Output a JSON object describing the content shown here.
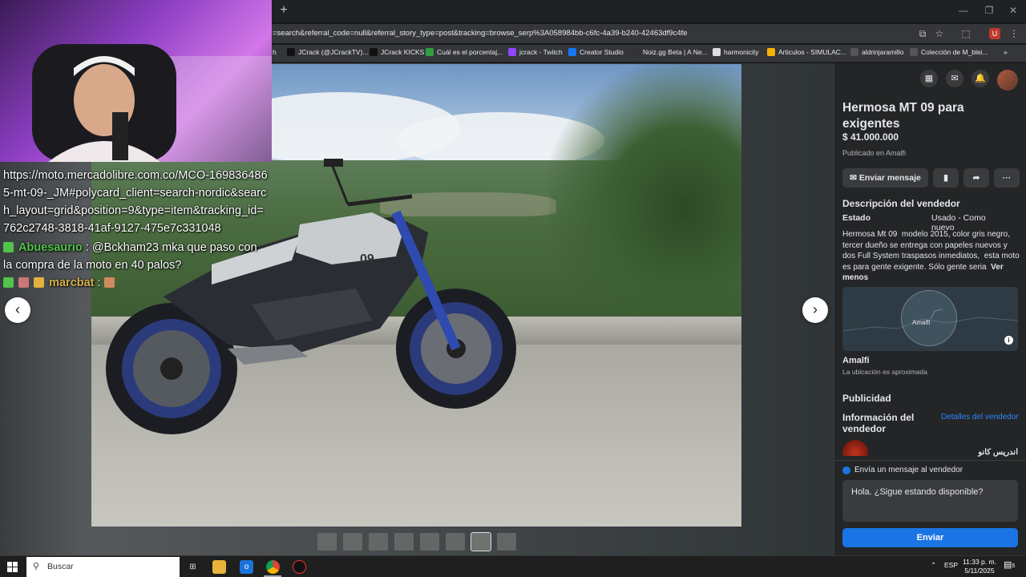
{
  "browser": {
    "url": "=search&referral_code=null&referral_story_type=post&tracking=browse_serp%3A058984bb-c6fc-4a39-b240-42463df9c4fe",
    "bookmarks": [
      {
        "label": "h",
        "color": "#444"
      },
      {
        "label": "JCrack (@JCrackTV)...",
        "color": "#111"
      },
      {
        "label": "JCrack KICKS",
        "color": "#111"
      },
      {
        "label": "Cuál es el porcentaj...",
        "color": "#2ea043"
      },
      {
        "label": "jcrack - Twitch",
        "color": "#9146ff"
      },
      {
        "label": "Creator Studio",
        "color": "#1877f2"
      },
      {
        "label": "Noiz.gg Beta | A Ne...",
        "color": "#333"
      },
      {
        "label": "harmonicity",
        "color": "#ddd"
      },
      {
        "label": "Articulos - SIMULAC...",
        "color": "#f4b400"
      },
      {
        "label": "aldrinjaramillo",
        "color": "#555"
      },
      {
        "label": "Colección de M_blei...",
        "color": "#555"
      }
    ]
  },
  "chat": {
    "link_message": "https://moto.mercadolibre.com.co/MCO-1698364865-mt-09-_JM#polycard_client=search-nordic&search_layout=grid&position=9&type=item&tracking_id=762c2748-3818-41af-9127-475e7c331048",
    "messages": [
      {
        "user": "Abuesaurio",
        "text": ": @Bckham23 mka que paso con la compra de la moto en 40 palos?"
      },
      {
        "user": "marcbat",
        "text": ":"
      }
    ]
  },
  "listing": {
    "title": "Hermosa MT 09 para exigentes",
    "price": "$ 41.000.000",
    "published": "Publicado en Amalfi",
    "send_message_label": "Enviar mensaje",
    "seller_desc_heading": "Descripción del vendedor",
    "condition_key": "Estado",
    "condition_value": "Usado - Como nuevo",
    "description": "Hermosa Mt 09 ⁣ modelo 2015, color gris negro, tercer dueño se entrega con papeles nuevos y dos Full System traspasos inmediatos, ⁣ esta moto es para gente exigente. Sólo gente seria ⁣",
    "see_less": "Ver menos",
    "map_label": "Amalfi",
    "location_name": "Amalfi",
    "location_note": "La ubicación es aproximada",
    "ads_heading": "Publicidad",
    "seller_info_heading": "Información del vendedor",
    "seller_details_link": "Detalles del vendedor",
    "seller_name": "اندريس كانو",
    "message_prompt": "Envía un mensaje al vendedor",
    "message_value": "Hola. ¿Sigue estando disponible?",
    "send_label": "Enviar"
  },
  "taskbar": {
    "search_placeholder": "Buscar",
    "language": "ESP",
    "time": "11:33 p. m.",
    "date": "5/11/2025",
    "notifications": "5"
  },
  "colors": {
    "accent": "#1b74e4",
    "panel": "#242526",
    "chat_user_green": "#53c24a",
    "chat_user_gold": "#d6b24c"
  }
}
